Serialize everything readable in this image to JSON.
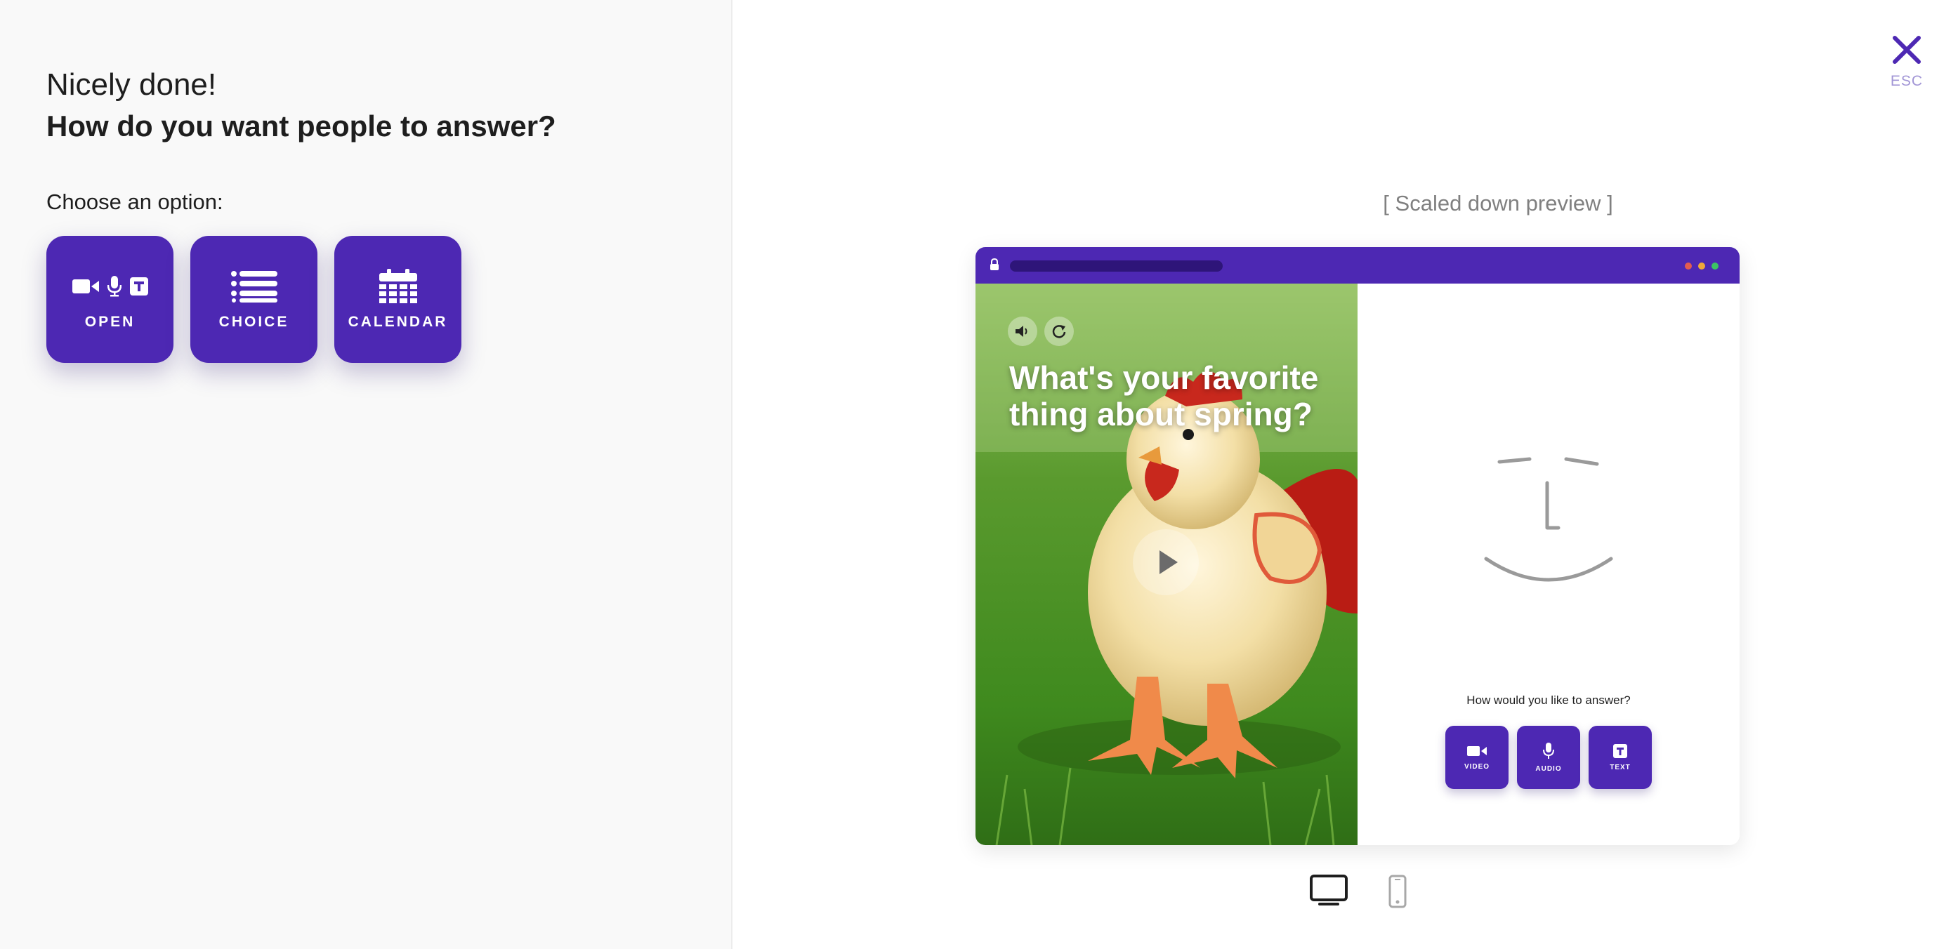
{
  "setup": {
    "greeting": "Nicely done!",
    "question": "How do you want people to answer?",
    "choose_label": "Choose an option:",
    "options": [
      {
        "label": "OPEN",
        "icons": [
          "video-icon",
          "microphone-icon",
          "text-icon"
        ]
      },
      {
        "label": "CHOICE",
        "icons": [
          "list-icon"
        ]
      },
      {
        "label": "CALENDAR",
        "icons": [
          "calendar-icon"
        ]
      }
    ]
  },
  "close": {
    "label": "ESC",
    "icon": "close-icon"
  },
  "preview": {
    "caption": "[ Scaled down preview ]",
    "question": "What's your favorite thing about spring?",
    "answer_prompt": "How would you like to answer?",
    "answer_buttons": [
      {
        "label": "VIDEO",
        "icon": "video-icon"
      },
      {
        "label": "AUDIO",
        "icon": "microphone-icon"
      },
      {
        "label": "TEXT",
        "icon": "text-icon"
      }
    ],
    "colors": {
      "accent": "#4d28b3",
      "dot_red": "#e25c4f",
      "dot_yellow": "#f0a73a",
      "dot_green": "#3cc265"
    }
  },
  "devices": [
    "desktop-icon",
    "mobile-icon"
  ]
}
